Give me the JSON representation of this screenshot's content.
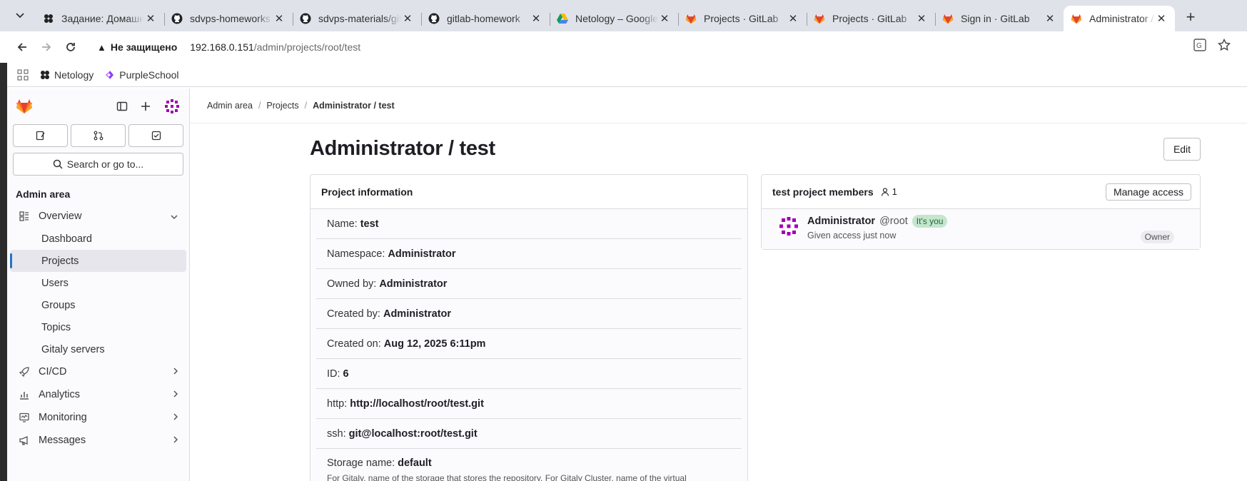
{
  "browser": {
    "tabs": [
      {
        "title": "Задание: Домашнее задание",
        "favicon": "netology-icon"
      },
      {
        "title": "sdvps-homeworks",
        "favicon": "github-icon"
      },
      {
        "title": "sdvps-materials/gitlab",
        "favicon": "github-icon"
      },
      {
        "title": "gitlab-homework",
        "favicon": "github-icon"
      },
      {
        "title": "Netology – Google Drive",
        "favicon": "drive-icon"
      },
      {
        "title": "Projects · GitLab",
        "favicon": "gitlab-icon"
      },
      {
        "title": "Projects · GitLab",
        "favicon": "gitlab-icon"
      },
      {
        "title": "Sign in · GitLab",
        "favicon": "gitlab-icon"
      },
      {
        "title": "Administrator / test",
        "favicon": "gitlab-icon",
        "active": true
      }
    ],
    "address": {
      "security_label": "Не защищено",
      "host": "192.168.0.151",
      "path": "/admin/projects/root/test"
    },
    "bookmarks": [
      {
        "label": "Netology",
        "icon": "netology-icon"
      },
      {
        "label": "PurpleSchool",
        "icon": "purpleschool-icon"
      }
    ]
  },
  "sidebar": {
    "search_label": "Search or go to...",
    "section_title": "Admin area",
    "items": [
      {
        "label": "Overview",
        "icon": "overview-icon",
        "expanded": true
      },
      {
        "label": "Dashboard",
        "sub": true
      },
      {
        "label": "Projects",
        "sub": true,
        "active": true
      },
      {
        "label": "Users",
        "sub": true
      },
      {
        "label": "Groups",
        "sub": true
      },
      {
        "label": "Topics",
        "sub": true
      },
      {
        "label": "Gitaly servers",
        "sub": true
      },
      {
        "label": "CI/CD",
        "icon": "rocket-icon"
      },
      {
        "label": "Analytics",
        "icon": "chart-icon"
      },
      {
        "label": "Monitoring",
        "icon": "monitor-icon"
      },
      {
        "label": "Messages",
        "icon": "megaphone-icon"
      }
    ]
  },
  "breadcrumb": [
    "Admin area",
    "Projects",
    "Administrator / test"
  ],
  "page": {
    "title": "Administrator / test",
    "edit_label": "Edit"
  },
  "project_info": {
    "heading": "Project information",
    "rows": [
      {
        "label": "Name:",
        "value": "test"
      },
      {
        "label": "Namespace:",
        "value": "Administrator"
      },
      {
        "label": "Owned by:",
        "value": "Administrator"
      },
      {
        "label": "Created by:",
        "value": "Administrator"
      },
      {
        "label": "Created on:",
        "value": "Aug 12, 2025 6:11pm"
      },
      {
        "label": "ID:",
        "value": "6"
      },
      {
        "label": "http:",
        "value": "http://localhost/root/test.git"
      },
      {
        "label": "ssh:",
        "value": "git@localhost:root/test.git"
      },
      {
        "label": "Storage name:",
        "value": "default"
      }
    ],
    "storage_note": "For Gitaly, name of the storage that stores the repository. For Gitaly Cluster, name of the virtual"
  },
  "members": {
    "heading": "test project members",
    "count": "1",
    "manage_label": "Manage access",
    "list": [
      {
        "name": "Administrator",
        "handle": "@root",
        "you_badge": "It's you",
        "meta": "Given access just now",
        "role": "Owner"
      }
    ]
  }
}
